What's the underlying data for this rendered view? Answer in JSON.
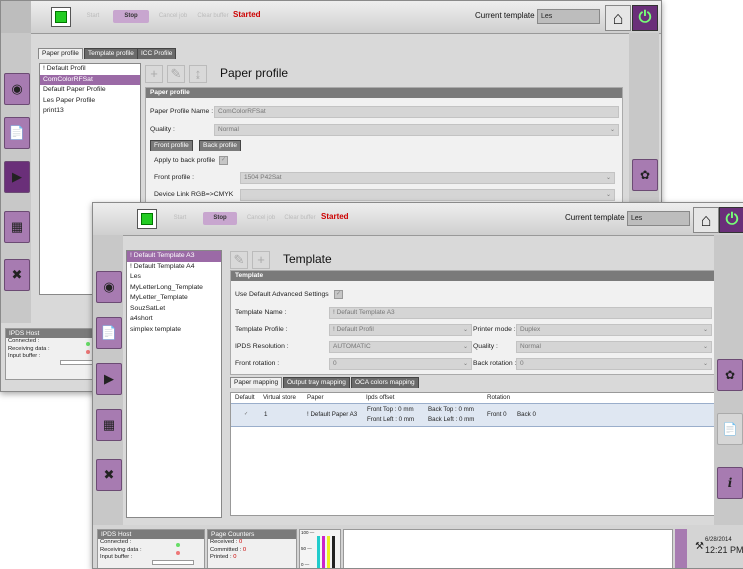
{
  "toolbar": {
    "start_label": "Start",
    "stop_label": "Stop",
    "cancel_job_label": "Cancel job",
    "clear_buffer_label": "Clear buffer",
    "status": "Started",
    "current_template_label": "Current template :",
    "current_template_value": "Les",
    "home_icon": "home-icon",
    "power_icon": "power-icon",
    "status_color": "#cc0000",
    "accent": "#6a2f79"
  },
  "back_window": {
    "tabs": [
      "Paper profile",
      "Template profile",
      "ICC Profile"
    ],
    "list": [
      "! Default Profil",
      "ComColorRFSat",
      "Default Paper Profile",
      "Les Paper Profile",
      "print13"
    ],
    "selected_index": 1,
    "page_title": "Paper profile",
    "group_title": "Paper profile",
    "profile_name_label": "Paper Profile Name :",
    "profile_name_value": "ComColorRFSat",
    "quality_label": "Quality :",
    "quality_value": "Normal",
    "sub_tabs": [
      "Front profile",
      "Back profile"
    ],
    "apply_back_label": "Apply to back profile",
    "front_profile_label": "Front profile :",
    "front_profile_value": "1504 P42Sat",
    "device_link_label": "Device Link RGB=>CMYK",
    "device_link_value": "",
    "ipds_host": {
      "title": "IPDS Host",
      "connected": "Connected :",
      "receiving": "Receiving data :",
      "input_buffer": "Input buffer :"
    }
  },
  "front_window": {
    "list": [
      "! Default Template A3",
      "! Default Template A4",
      "Les",
      "MyLetterLong_Template",
      "MyLetter_Template",
      "SouzSatLet",
      "a4short",
      "simplex template"
    ],
    "selected_index": 0,
    "page_title": "Template",
    "group_title": "Template",
    "use_default_label": "Use Default Advanced Settings",
    "template_name_label": "Template Name :",
    "template_name_value": "! Default Template A3",
    "template_profile_label": "Template Profile :",
    "template_profile_value": "! Default Profil",
    "printer_mode_label": "Printer mode :",
    "printer_mode_value": "Duplex",
    "ipds_resolution_label": "IPDS Resolution :",
    "ipds_resolution_value": "AUTOMATIC",
    "quality_label": "Quality :",
    "quality_value": "Normal",
    "front_rotation_label": "Front rotation :",
    "front_rotation_value": "0",
    "back_rotation_label": "Back rotation :",
    "back_rotation_value": "0",
    "mapping_tabs": [
      "Paper mapping",
      "Output tray mapping",
      "OCA colors mapping"
    ],
    "table_headers": [
      "Default",
      "Virtual store",
      "Paper",
      "Ipds offset",
      "Rotation"
    ],
    "table_row": {
      "default": "✓",
      "virtual_store": "1",
      "paper": "! Default Paper A3",
      "front_top": "Front Top : 0 mm",
      "back_top": "Back Top : 0 mm",
      "front_left": "Front Left : 0 mm",
      "back_left": "Back Left : 0 mm",
      "front_rot": "Front  0",
      "back_rot": "Back  0"
    },
    "ipds_host": {
      "title": "IPDS Host",
      "connected": "Connected :",
      "receiving": "Receiving data :",
      "input_buffer": "Input buffer :"
    },
    "page_counters": {
      "title": "Page Counters",
      "received": "Received :",
      "received_value": "0",
      "committed": "Committed :",
      "committed_value": "0",
      "printed": "Printed :",
      "printed_value": "0"
    },
    "meter_labels": [
      "100 —",
      "50 —",
      "0 —"
    ],
    "date": "6/28/2014",
    "time": "12:21 PM"
  }
}
